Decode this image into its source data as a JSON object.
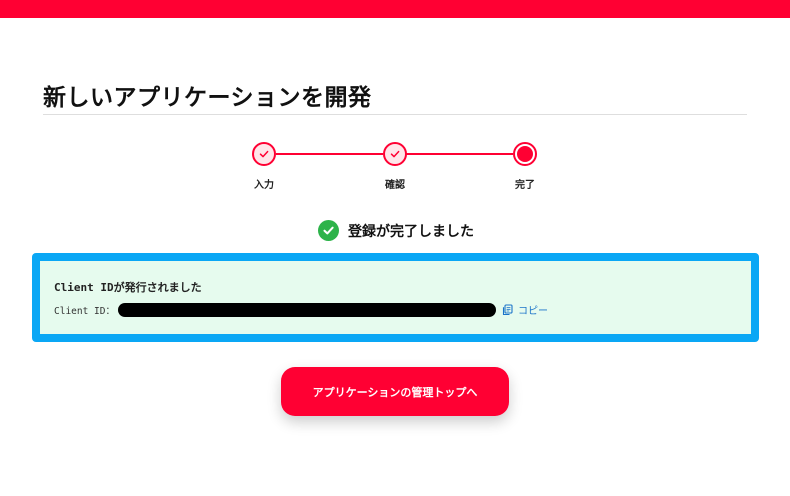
{
  "header": {
    "accent_color": "#ff0033"
  },
  "page": {
    "title": "新しいアプリケーションを開発"
  },
  "stepper": {
    "steps": [
      {
        "label": "入力",
        "state": "done",
        "icon": "check-icon"
      },
      {
        "label": "確認",
        "state": "done",
        "icon": "check-icon"
      },
      {
        "label": "完了",
        "state": "current",
        "icon": "current-dot"
      }
    ]
  },
  "status": {
    "message": "登録が完了しました",
    "icon": "check-circle-icon",
    "color": "#2db34a"
  },
  "result": {
    "heading": "Client IDが発行されました",
    "client_id_label": "Client ID：",
    "client_id_value": "",
    "copy_label": "コピー",
    "copy_icon": "copy-icon",
    "border_color": "#0aa7f5"
  },
  "actions": {
    "primary_label": "アプリケーションの管理トップへ"
  }
}
